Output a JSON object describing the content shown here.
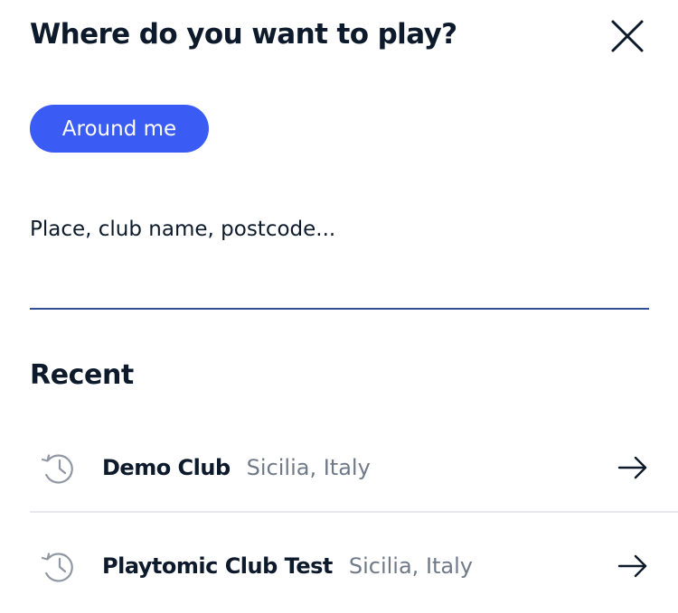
{
  "header": {
    "title": "Where do you want to play?"
  },
  "filter": {
    "around_me_label": "Around me"
  },
  "search": {
    "placeholder": "Place, club name, postcode...",
    "value": ""
  },
  "recent": {
    "heading": "Recent",
    "items": [
      {
        "name": "Demo Club",
        "location": "Sicilia, Italy"
      },
      {
        "name": "Playtomic Club Test",
        "location": "Sicilia, Italy"
      }
    ]
  },
  "icons": {
    "close": "close-icon",
    "history": "history-icon",
    "arrow": "arrow-right-icon"
  },
  "colors": {
    "accent": "#3b5cf4",
    "text_primary": "#0d1a2b",
    "text_secondary": "#6f7987",
    "input_underline": "#2f4f9c",
    "divider": "#e6e8ec"
  }
}
